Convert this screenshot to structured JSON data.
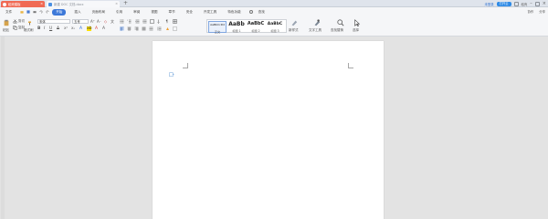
{
  "tabs": [
    {
      "label": "稻壳模板",
      "active": false
    },
    {
      "label": "新建 DOC 文档.docx",
      "active": true
    }
  ],
  "top_right": {
    "login": "未登录",
    "open": "打开云",
    "menu_b": "稻壳"
  },
  "menubar": {
    "file_label": "文件",
    "items": [
      "开始",
      "插入",
      "页面布局",
      "引用",
      "审阅",
      "视图",
      "章节",
      "安全",
      "开发工具",
      "特色功能"
    ],
    "search": "查找",
    "right": [
      "协作",
      "分享"
    ]
  },
  "ribbon": {
    "paste_label": "粘贴",
    "cut_label": "剪切",
    "copy_label": "复制",
    "format_painter_label": "格式刷",
    "font_name": "宋体",
    "font_size": "五号",
    "styles": [
      {
        "preview": "AaBbCcDd",
        "label": "正文"
      },
      {
        "preview": "AaBb",
        "label": "标题 1"
      },
      {
        "preview": "AaBbC",
        "label": "标题 2"
      },
      {
        "preview": "AaBbC",
        "label": "标题 3"
      }
    ],
    "new_style_label": "新样式",
    "text_tool_label": "文字工具",
    "find_replace_label": "查找替换",
    "select_label": "选择"
  }
}
